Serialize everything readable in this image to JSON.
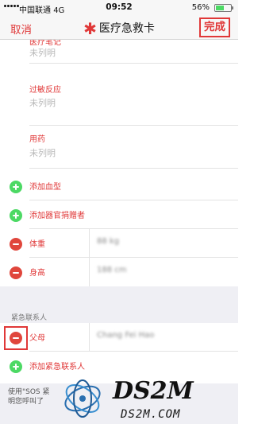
{
  "status_bar": {
    "carrier": "中国联通",
    "network": "4G",
    "time": "09:52",
    "battery": "56%",
    "battery_level": 0.56
  },
  "nav": {
    "cancel": "取消",
    "title": "医疗急救卡",
    "done": "完成"
  },
  "fields": [
    {
      "label": "医疗笔记",
      "value": "未列明"
    },
    {
      "label": "过敏反应",
      "value": "未列明"
    },
    {
      "label": "用药",
      "value": "未列明"
    }
  ],
  "rows": {
    "add_blood_type": "添加血型",
    "add_organ_donor": "添加器官捐赠者",
    "weight_label": "体重",
    "weight_value": "88 kg",
    "height_label": "身高",
    "height_value": "188 cm"
  },
  "emergency": {
    "section_title": "紧急联系人",
    "contact_label": "父母",
    "contact_value": "Chang Fei Hao",
    "add_contact": "添加紧急联系人"
  },
  "footer": {
    "note_line1": "使用\"SOS 紧",
    "note_line2": "明您呼叫了"
  },
  "watermark": {
    "logo_text": "DS2M",
    "url_text": "DS2M.COM"
  },
  "colors": {
    "accent": "#e03838",
    "add": "#4cd964",
    "remove": "#e0463c",
    "battery": "#4cd964"
  }
}
